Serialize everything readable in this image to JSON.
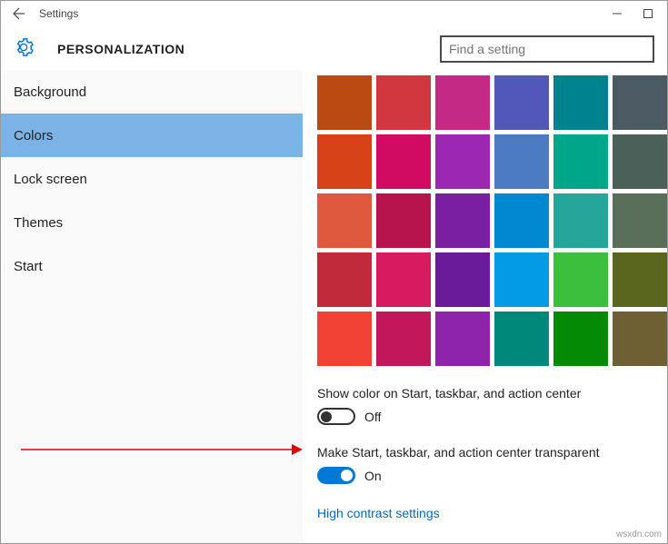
{
  "titlebar": {
    "window_title": "Settings"
  },
  "header": {
    "page_title": "PERSONALIZATION",
    "search_placeholder": "Find a setting"
  },
  "sidebar": {
    "items": [
      {
        "label": "Background",
        "active": false
      },
      {
        "label": "Colors",
        "active": true
      },
      {
        "label": "Lock screen",
        "active": false
      },
      {
        "label": "Themes",
        "active": false
      },
      {
        "label": "Start",
        "active": false
      }
    ]
  },
  "colors": {
    "palette": [
      "#bb4a12",
      "#d1373e",
      "#c52986",
      "#5158b7",
      "#00828f",
      "#4b5a63",
      "#d64117",
      "#d10b62",
      "#9c27b0",
      "#4d7bc3",
      "#00a68a",
      "#4b6058",
      "#df593f",
      "#b7144e",
      "#7b1fa2",
      "#0288d1",
      "#26a69a",
      "#5a6f5a",
      "#c02a3a",
      "#d81b60",
      "#6a1b9a",
      "#039be5",
      "#3cbf3c",
      "#5a651e",
      "#f24235",
      "#c2185b",
      "#8e24aa",
      "#00897b",
      "#048a04",
      "#6e6033"
    ]
  },
  "options": {
    "show_color_label": "Show color on Start, taskbar, and action center",
    "show_color_state": "Off",
    "transparent_label": "Make Start, taskbar, and action center transparent",
    "transparent_state": "On",
    "high_contrast_link": "High contrast settings"
  },
  "watermark": "wsxdn.com"
}
